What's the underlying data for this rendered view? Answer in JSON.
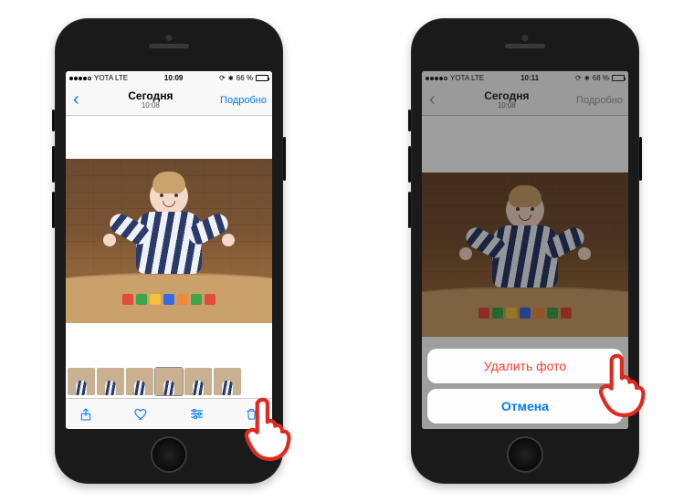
{
  "phone1": {
    "status": {
      "carrier": "YOTA  LTE",
      "time": "10:09",
      "battery_text": "66 %",
      "battery_level": 66
    },
    "nav": {
      "title": "Сегодня",
      "subtitle": "10:08",
      "detail": "Подробно"
    },
    "toolbar": {
      "share_icon": "share-icon",
      "heart_icon": "heart-icon",
      "sliders_icon": "sliders-icon",
      "trash_icon": "trash-icon"
    }
  },
  "phone2": {
    "status": {
      "carrier": "YOTA  LTE",
      "time": "10:11",
      "battery_text": "68 %",
      "battery_level": 68
    },
    "nav": {
      "title": "Сегодня",
      "subtitle": "10:08",
      "detail": "Подробно"
    },
    "sheet": {
      "delete": "Удалить фото",
      "cancel": "Отмена"
    }
  },
  "colors": {
    "ios_blue": "#007aff",
    "ios_red": "#ff3b30",
    "pointer_red": "#e02a1f"
  }
}
